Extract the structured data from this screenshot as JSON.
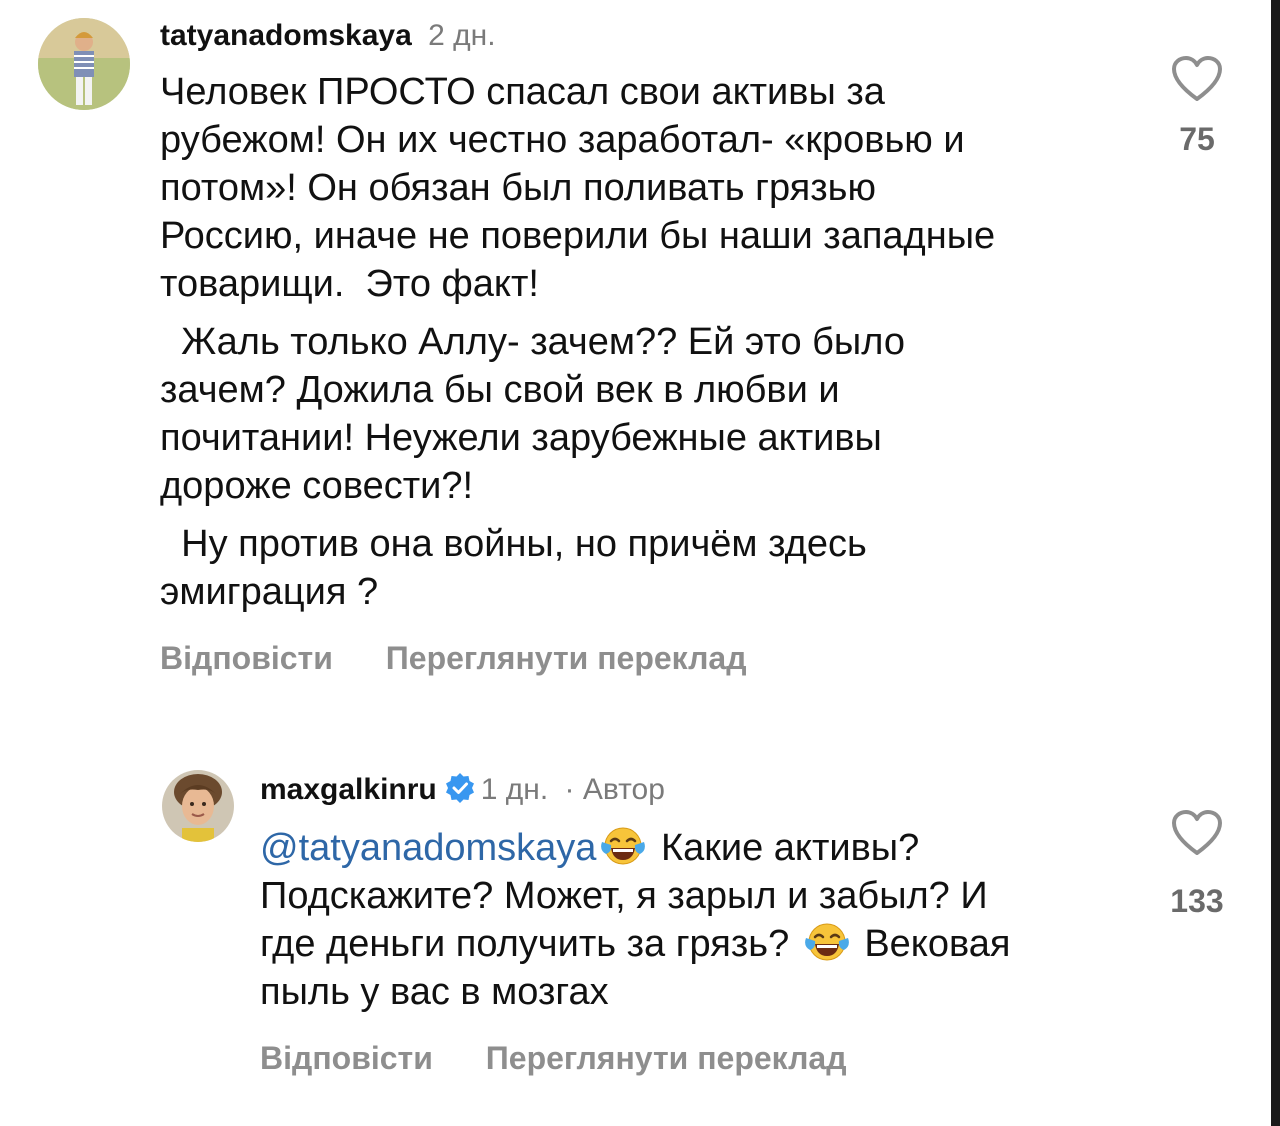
{
  "comments": [
    {
      "username": "tatyanadomskaya",
      "time": "2 дн.",
      "paragraphs": [
        "Человек ПРОСТО спасал свои активы за\nрубежом! Он их честно заработал- «кровью и\nпотом»! Он обязан был поливать грязью\nРоссию, иначе не поверили бы наши западные\nтоварищи.  Это факт!",
        "  Жаль только Аллу- зачем?? Ей это было\nзачем? Дожила бы свой век в любви и\nпочитании! Неужели зарубежные активы\nдороже совести?!",
        "  Ну против она войны, но причём здесь\nэмиграция ?"
      ],
      "reply_label": "Відповісти",
      "translate_label": "Переглянути переклад",
      "likes": "75",
      "avatar_icon": "user-photo-avatar",
      "like_icon": "heart-outline-icon"
    },
    {
      "username": "maxgalkinru",
      "verified_icon": "verified-badge-icon",
      "time": "1 дн.",
      "separator": "·",
      "author_label": "Автор",
      "mention": "@tatyanadomskaya",
      "text_1": " Какие активы?\nПодскажите? Может, я зарыл и забыл? И\nгде деньги получить за грязь? ",
      "text_2": " Вековая\nпыль у вас в мозгах",
      "emoji_icon": "tears-of-joy-emoji-icon",
      "reply_label": "Відповісти",
      "translate_label": "Переглянути переклад",
      "likes": "133",
      "avatar_icon": "user-photo-avatar",
      "like_icon": "heart-outline-icon"
    }
  ],
  "colors": {
    "mention": "#2e67a7",
    "verified": "#3897f0",
    "muted": "#8e8e8e",
    "text": "#111111"
  }
}
